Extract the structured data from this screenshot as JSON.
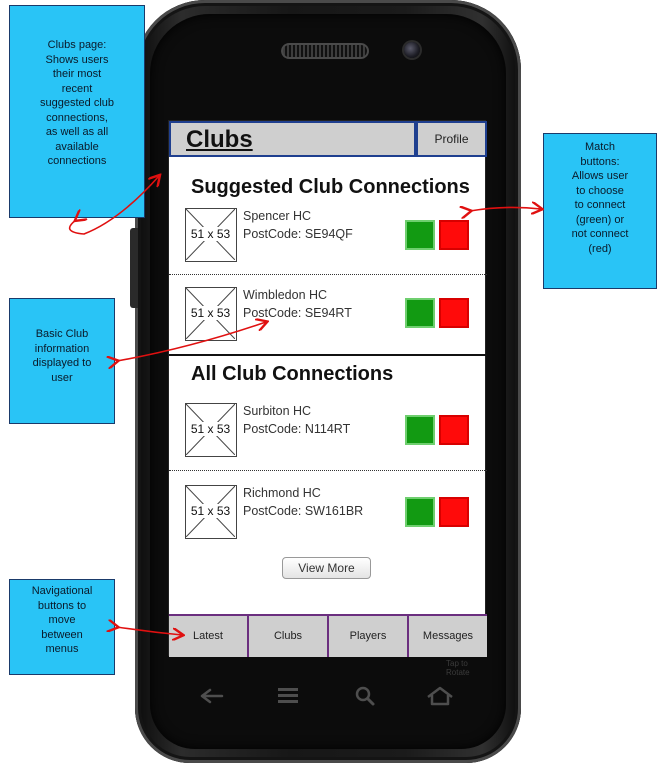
{
  "app": {
    "title": "Clubs",
    "profile_label": "Profile"
  },
  "sections": {
    "suggested": "Suggested Club Connections",
    "all": "All Club Connections"
  },
  "thumb_placeholder": "51 x 53",
  "clubs": [
    {
      "name": "Spencer HC",
      "postcode": "PostCode: SE94QF"
    },
    {
      "name": "Wimbledon HC",
      "postcode": "PostCode: SE94RT"
    },
    {
      "name": "Surbiton HC",
      "postcode": "PostCode: N114RT"
    },
    {
      "name": "Richmond HC",
      "postcode": "PostCode: SW161BR"
    }
  ],
  "view_more_label": "View More",
  "bottom_nav": [
    {
      "label": "Latest"
    },
    {
      "label": "Clubs"
    },
    {
      "label": "Players"
    },
    {
      "label": "Messages"
    }
  ],
  "footer_faint": [
    "Tap to",
    "Rotate"
  ],
  "annotations": {
    "clubs_page": [
      "Clubs page:",
      "Shows users",
      "their most",
      "recent",
      "suggested club",
      "connections,",
      "as well as all",
      "available",
      "connections"
    ],
    "match_buttons": [
      "Match",
      "buttons:",
      "Allows user",
      "to choose",
      "to connect",
      "(green) or",
      "not connect",
      "(red)"
    ],
    "basic_info": [
      "Basic Club",
      "information",
      "displayed to",
      "user"
    ],
    "nav_buttons": [
      "Navigational",
      "buttons to",
      "move",
      "between",
      "menus"
    ]
  },
  "colors": {
    "accept": "#129a12",
    "reject": "#ff0a0a",
    "annotation": "#29c4f6",
    "header_border": "#1f3f8f",
    "nav_border": "#6b2f7f"
  },
  "icons": {
    "hw_back": "back-icon",
    "hw_home": "home-icon",
    "hw_menu": "menu-icon",
    "hw_search": "search-icon"
  }
}
